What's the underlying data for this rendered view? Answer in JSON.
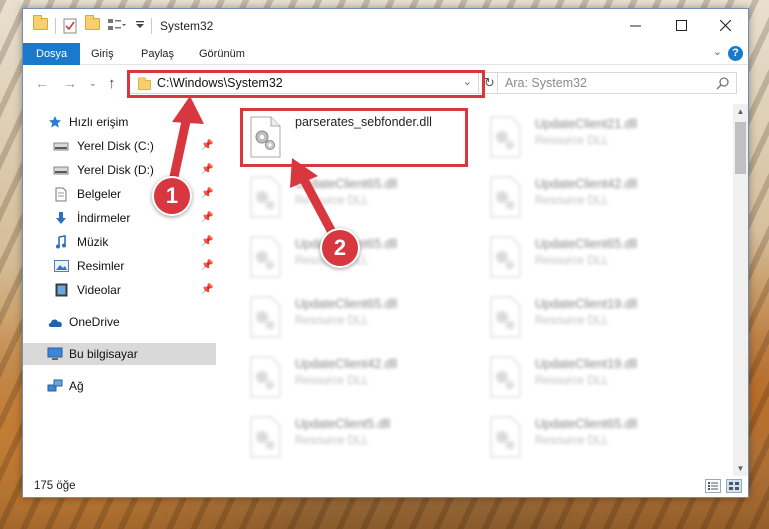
{
  "window": {
    "title": "System32"
  },
  "ribbon": {
    "tabs": [
      "Dosya",
      "Giriş",
      "Paylaş",
      "Görünüm"
    ]
  },
  "address": {
    "path": "C:\\Windows\\System32",
    "search_placeholder": "Ara: System32"
  },
  "sidebar": {
    "quick_access": "Hızlı erişim",
    "pinned": [
      {
        "label": "Yerel Disk (C:)",
        "icon": "drive-icon"
      },
      {
        "label": "Yerel Disk (D:)",
        "icon": "drive-icon"
      },
      {
        "label": "Belgeler",
        "icon": "documents-icon"
      },
      {
        "label": "İndirmeler",
        "icon": "downloads-icon"
      },
      {
        "label": "Müzik",
        "icon": "music-icon"
      },
      {
        "label": "Resimler",
        "icon": "pictures-icon"
      },
      {
        "label": "Videolar",
        "icon": "videos-icon"
      }
    ],
    "onedrive": "OneDrive",
    "this_pc": "Bu bilgisayar",
    "network": "Ağ"
  },
  "files": [
    {
      "name": "parserates_sebfonder.dll",
      "type": "",
      "highlighted": true
    },
    {
      "name": "UpdateClient21.dll",
      "type": "Resource DLL"
    },
    {
      "name": "UpdateClient65.dll",
      "type": "Resource DLL"
    },
    {
      "name": "UpdateClient42.dll",
      "type": "Resource DLL"
    },
    {
      "name": "UpdateClient65.dll",
      "type": "Resource DLL"
    },
    {
      "name": "UpdateClient65.dll",
      "type": "Resource DLL"
    },
    {
      "name": "UpdateClient65.dll",
      "type": "Resource DLL"
    },
    {
      "name": "UpdateClient19.dll",
      "type": "Resource DLL"
    },
    {
      "name": "UpdateClient42.dll",
      "type": "Resource DLL"
    },
    {
      "name": "UpdateClient19.dll",
      "type": "Resource DLL"
    },
    {
      "name": "UpdateClient5.dll",
      "type": "Resource DLL"
    },
    {
      "name": "UpdateClient65.dll",
      "type": "Resource DLL"
    }
  ],
  "status": {
    "item_count": "175 öğe"
  },
  "callouts": [
    "1",
    "2"
  ],
  "colors": {
    "accent": "#1979ca",
    "highlight": "#d9373f"
  }
}
